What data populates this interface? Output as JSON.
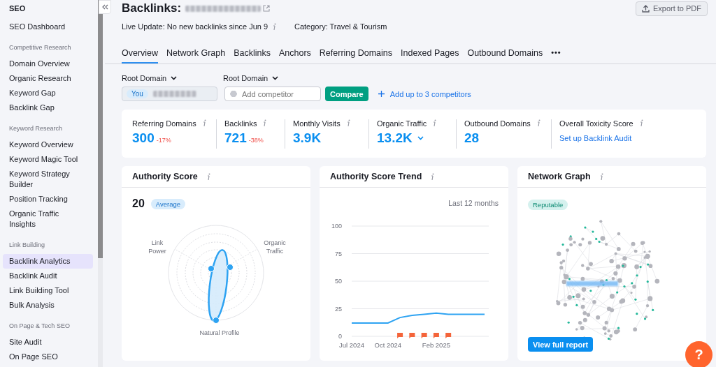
{
  "sidebar": {
    "title": "SEO",
    "items": [
      {
        "label": "SEO Dashboard",
        "selected": false
      }
    ],
    "sections": [
      {
        "heading": "Competitive Research",
        "items": [
          {
            "label": "Domain Overview",
            "selected": false
          },
          {
            "label": "Organic Research",
            "selected": false
          },
          {
            "label": "Keyword Gap",
            "selected": false
          },
          {
            "label": "Backlink Gap",
            "selected": false
          }
        ]
      },
      {
        "heading": "Keyword Research",
        "items": [
          {
            "label": "Keyword Overview",
            "selected": false
          },
          {
            "label": "Keyword Magic Tool",
            "selected": false
          },
          {
            "label": "Keyword Strategy Builder",
            "selected": false
          },
          {
            "label": "Position Tracking",
            "selected": false
          },
          {
            "label": "Organic Traffic Insights",
            "selected": false
          }
        ]
      },
      {
        "heading": "Link Building",
        "items": [
          {
            "label": "Backlink Analytics",
            "selected": true
          },
          {
            "label": "Backlink Audit",
            "selected": false
          },
          {
            "label": "Link Building Tool",
            "selected": false
          },
          {
            "label": "Bulk Analysis",
            "selected": false
          }
        ]
      },
      {
        "heading": "On Page & Tech SEO",
        "items": [
          {
            "label": "Site Audit",
            "selected": false
          },
          {
            "label": "On Page SEO",
            "selected": false
          }
        ]
      }
    ]
  },
  "header": {
    "title": "Backlinks:",
    "live_update": "Live Update: No new backlinks since Jun 9",
    "category": "Category: Travel & Tourism",
    "export_button": "Export to PDF"
  },
  "tabs": [
    {
      "label": "Overview",
      "selected": true
    },
    {
      "label": "Network Graph",
      "selected": false
    },
    {
      "label": "Backlinks",
      "selected": false
    },
    {
      "label": "Anchors",
      "selected": false
    },
    {
      "label": "Referring Domains",
      "selected": false
    },
    {
      "label": "Indexed Pages",
      "selected": false
    },
    {
      "label": "Outbound Domains",
      "selected": false
    }
  ],
  "tabs_more": "•••",
  "compare": {
    "domain_type_1": "Root Domain",
    "domain_type_2": "Root Domain",
    "you_badge": "You",
    "competitor_placeholder": "Add competitor",
    "compare_button": "Compare",
    "add_link": "Add up to 3 competitors"
  },
  "metrics": [
    {
      "kind": "number",
      "label": "Referring Domains",
      "value": "300",
      "change": "-17%"
    },
    {
      "kind": "number",
      "label": "Backlinks",
      "value": "721",
      "change": "-38%"
    },
    {
      "kind": "number",
      "label": "Monthly Visits",
      "value": "3.9K"
    },
    {
      "kind": "dropdown",
      "label": "Organic Traffic",
      "value": "13.2K"
    },
    {
      "kind": "number",
      "label": "Outbound Domains",
      "value": "28"
    },
    {
      "kind": "link",
      "label": "Overall Toxicity Score",
      "value": "Set up Backlink Audit"
    }
  ],
  "authority_score": {
    "title": "Authority Score",
    "score": "20",
    "badge": "Average",
    "axes": [
      "Link Power",
      "Organic Traffic",
      "Natural Profile"
    ]
  },
  "trend": {
    "title": "Authority Score Trend",
    "period": "Last 12 months",
    "chart_data": {
      "type": "line",
      "categories": [
        "Jul 2024",
        null,
        null,
        "Oct 2024",
        null,
        null,
        null,
        "Feb 2025",
        null,
        null,
        null,
        null
      ],
      "series": [
        {
          "color": "#2ea3f2",
          "values": [
            12,
            12,
            12,
            12,
            17,
            19,
            20,
            21,
            20,
            20,
            20,
            20
          ]
        }
      ],
      "ylim": [
        0,
        100
      ],
      "yticks": [
        0,
        25,
        50,
        75,
        100
      ],
      "grid": true
    },
    "events": [
      {
        "kind": "flag"
      },
      {
        "kind": "flag"
      },
      {
        "kind": "flag"
      },
      {
        "kind": "flag"
      },
      {
        "kind": "flag"
      }
    ]
  },
  "network_graph": {
    "title": "Network Graph",
    "badge": "Reputable",
    "button": "View full report"
  },
  "help_button": "?"
}
